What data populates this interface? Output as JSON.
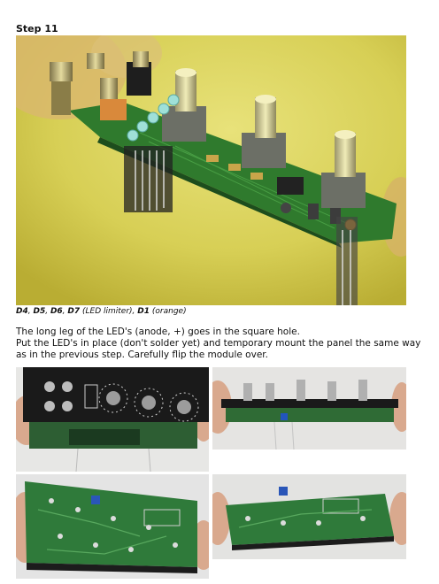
{
  "step_title": "Step 11",
  "caption": {
    "parts": [
      {
        "text": "D4",
        "bold": true
      },
      {
        "text": ", ",
        "bold": false
      },
      {
        "text": "D5",
        "bold": true
      },
      {
        "text": ", ",
        "bold": false
      },
      {
        "text": "D6",
        "bold": true
      },
      {
        "text": ", ",
        "bold": false
      },
      {
        "text": "D7",
        "bold": true
      },
      {
        "text": " (LED limiter), ",
        "bold": false
      },
      {
        "text": "D1",
        "bold": true
      },
      {
        "text": " (orange)",
        "bold": false
      }
    ]
  },
  "instructions": [
    "The long leg of the LED's (anode, +) goes in the square hole.",
    "Put the LED's in place (don't solder yet) and temporary mount the panel the same way as in the previous step. Carefully flip the module over."
  ]
}
